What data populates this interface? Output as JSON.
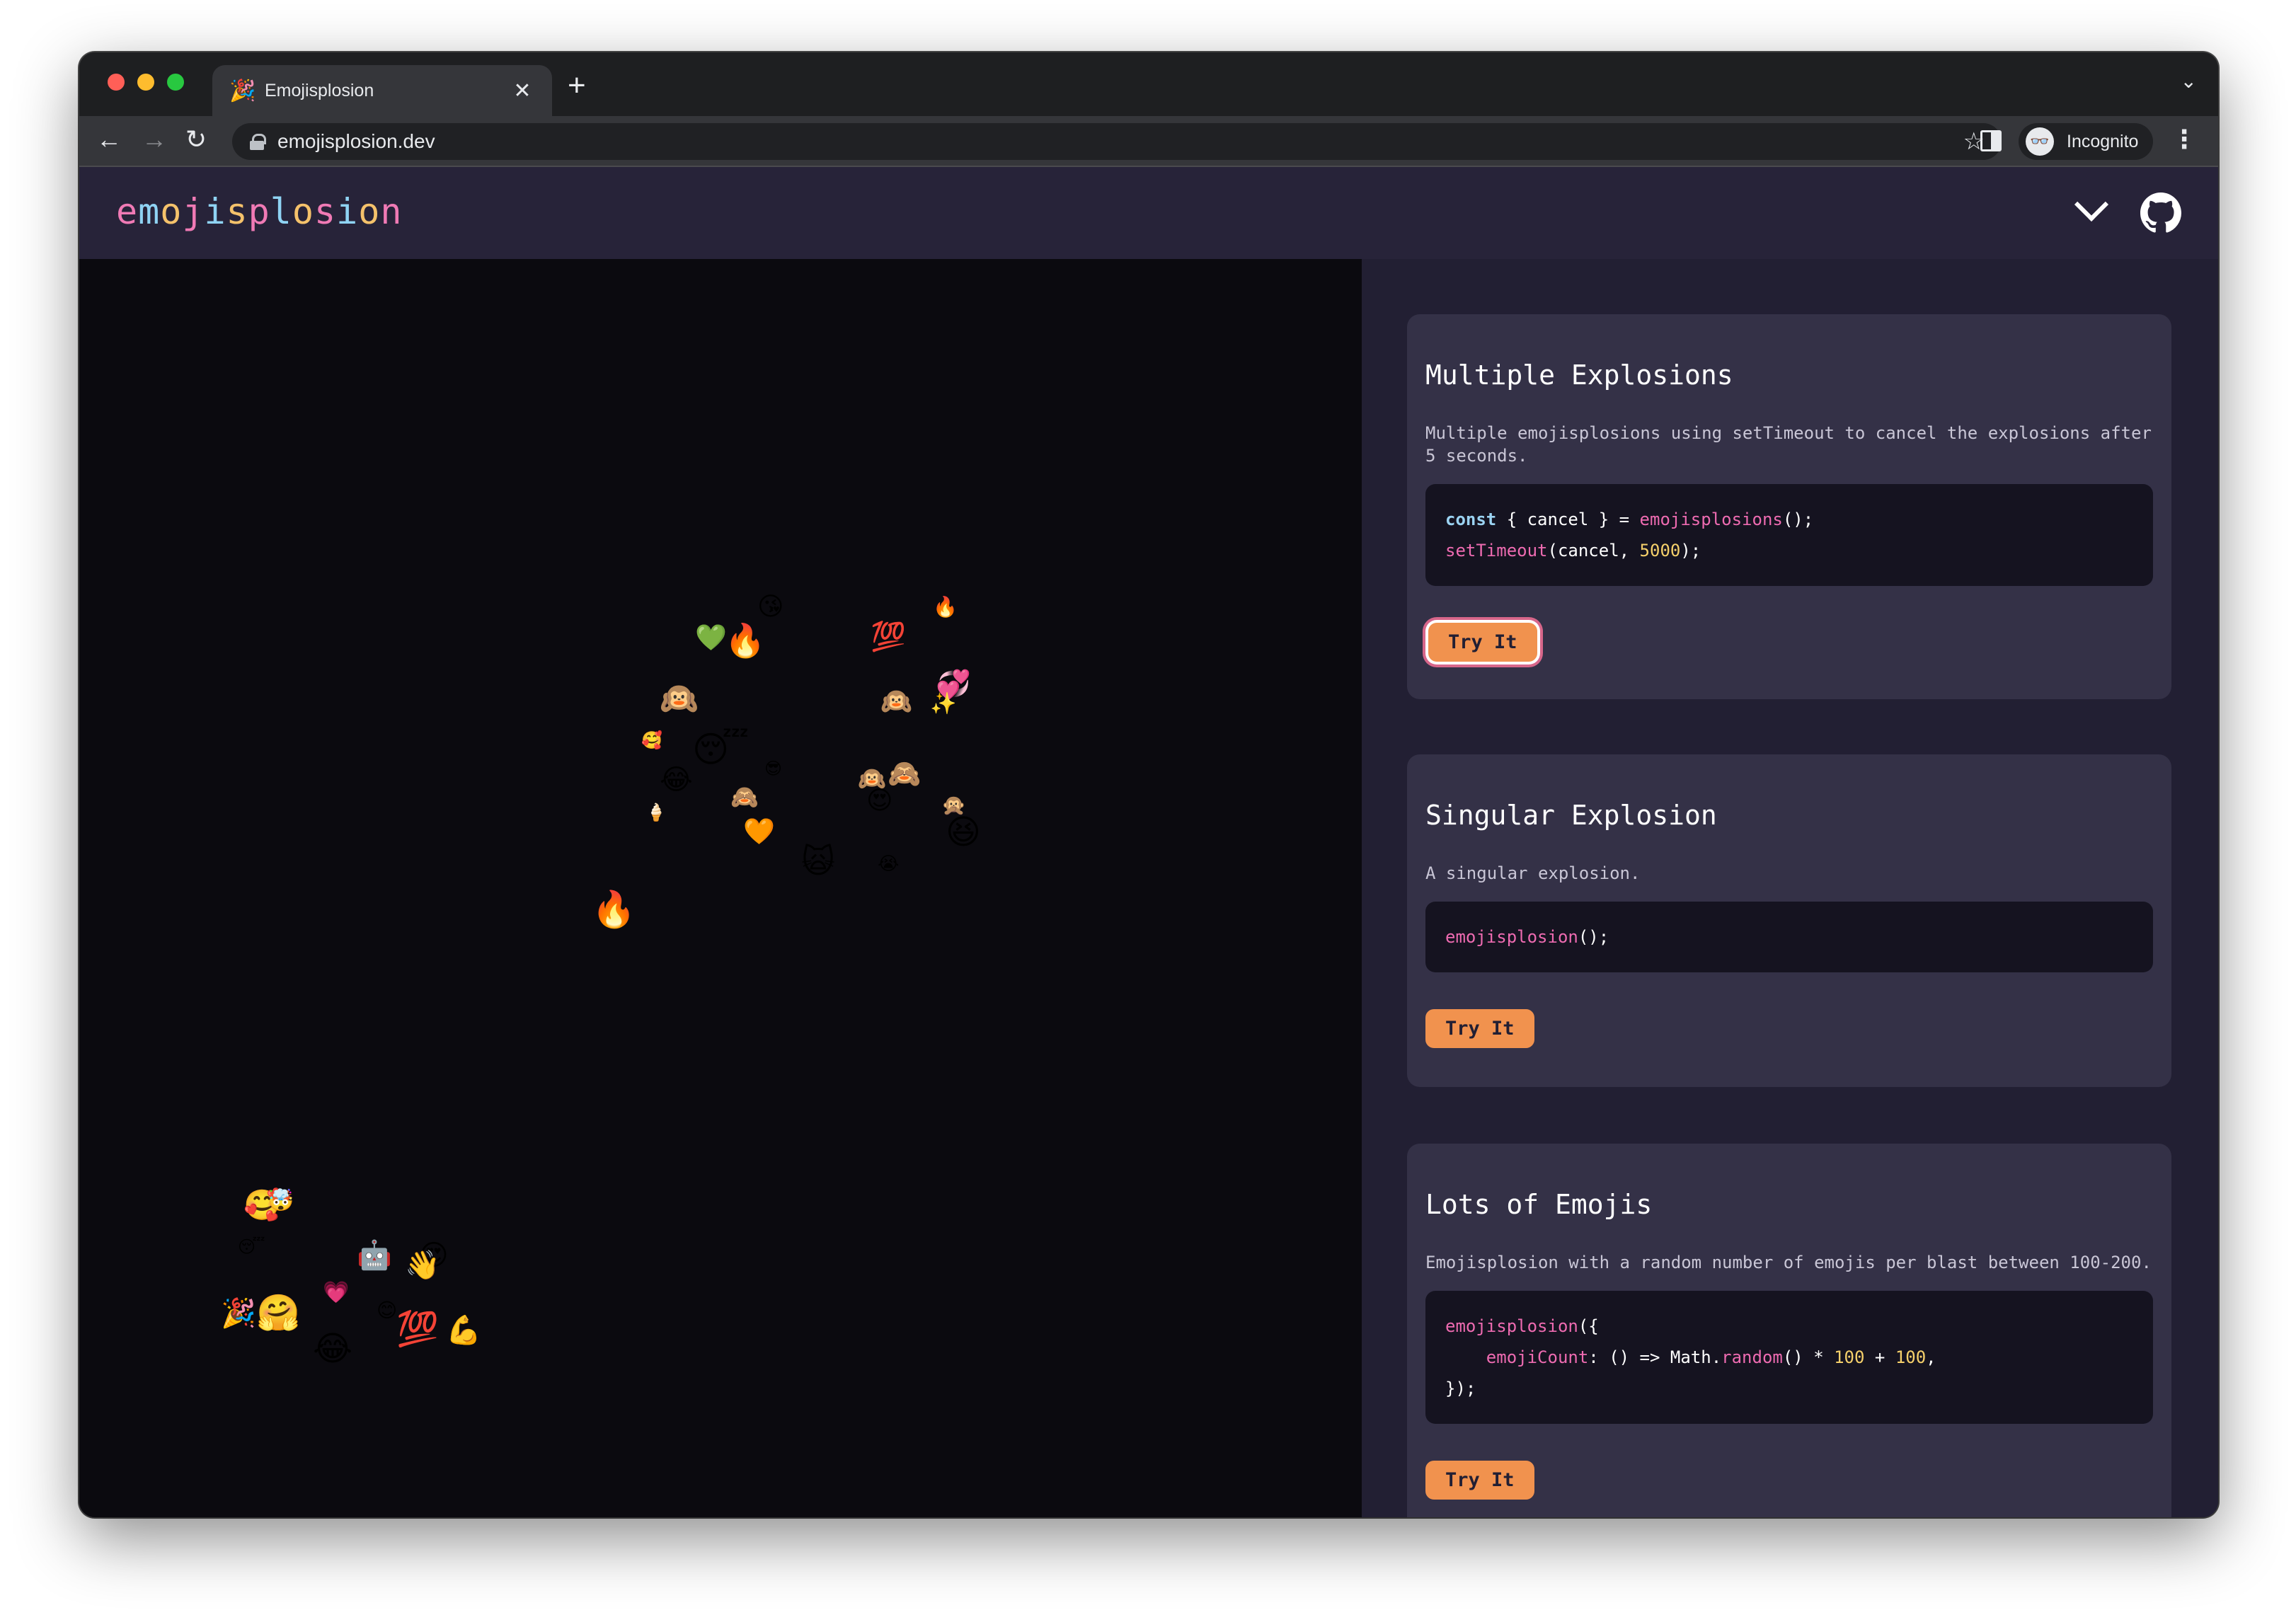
{
  "browser": {
    "tab_title": "Emojisplosion",
    "tab_favicon": "🎉",
    "tab_close": "✕",
    "new_tab": "+",
    "tab_menu": "⌄",
    "url": "emojisplosion.dev",
    "star_icon": "☆",
    "incognito_label": "Incognito",
    "incognito_icon": "👓",
    "kebab": "⋮",
    "back": "←",
    "forward": "→",
    "reload": "↻"
  },
  "header": {
    "logo_letters": [
      "e",
      "m",
      "o",
      "j",
      "i",
      "s",
      "p",
      "l",
      "o",
      "s",
      "i",
      "o",
      "n"
    ],
    "logo_colors": [
      "#f07ab5",
      "#8fd3f4",
      "#f5c26b",
      "#f07ab5",
      "#8fd3f4",
      "#f5c26b",
      "#f07ab5",
      "#8fd3f4",
      "#f5c26b",
      "#f07ab5",
      "#8fd3f4",
      "#f5c26b",
      "#f07ab5"
    ]
  },
  "canvas_emojis": [
    "💚",
    "🔥",
    "😘",
    "💯",
    "🔥",
    "🙉",
    "🥰",
    "💞",
    "😴",
    "🙉",
    "✨",
    "😂",
    "🙈",
    "😎",
    "🙈",
    "🍦",
    "😍",
    "🙊",
    "😆",
    "🧡",
    "🙀",
    "😭",
    "🔥",
    "🙉",
    "🥰",
    "🤯",
    "😴",
    "😍",
    "🤖",
    "👋",
    "💗",
    "😊",
    "🎉",
    "🤗",
    "😂",
    "💯",
    "💪"
  ],
  "cards": [
    {
      "title": "Multiple Explosions",
      "description": "Multiple emojisplosions using setTimeout to cancel the explosions after 5 seconds.",
      "code": [
        [
          {
            "t": "const",
            "c": "kw"
          },
          {
            "t": " { cancel } = "
          },
          {
            "t": "emojisplosions",
            "c": "fn"
          },
          {
            "t": "();"
          }
        ],
        [
          {
            "t": "setTimeout",
            "c": "fn"
          },
          {
            "t": "(cancel, "
          },
          {
            "t": "5000",
            "c": "num"
          },
          {
            "t": ");"
          }
        ]
      ],
      "button": "Try It"
    },
    {
      "title": "Singular Explosion",
      "description": "A singular explosion.",
      "code": [
        [
          {
            "t": "emojisplosion",
            "c": "fn"
          },
          {
            "t": "();"
          }
        ]
      ],
      "button": "Try It"
    },
    {
      "title": "Lots of Emojis",
      "description": "Emojisplosion with a random number of emojis per blast between 100-200.",
      "code": [
        [
          {
            "t": "emojisplosion",
            "c": "fn"
          },
          {
            "t": "({"
          }
        ],
        [
          {
            "t": "    "
          },
          {
            "t": "emojiCount",
            "c": "fn"
          },
          {
            "t": ": () => Math."
          },
          {
            "t": "random",
            "c": "fn"
          },
          {
            "t": "() * "
          },
          {
            "t": "100",
            "c": "num"
          },
          {
            "t": " + "
          },
          {
            "t": "100",
            "c": "num"
          },
          {
            "t": ","
          }
        ],
        [
          {
            "t": "});"
          }
        ]
      ],
      "button": "Try It"
    }
  ]
}
